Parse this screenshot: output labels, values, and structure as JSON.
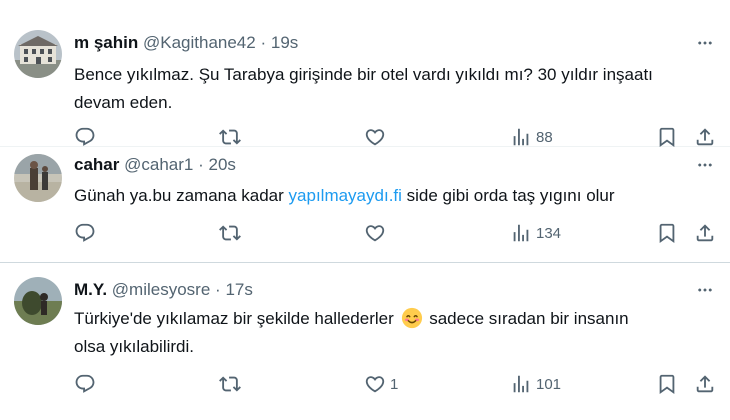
{
  "tweets": [
    {
      "name": "m şahin",
      "handle": "@Kagithane42",
      "separator": "·",
      "time": "19s",
      "text_lines": [
        "Bence yıkılmaz. Şu Tarabya girişinde bir otel vardı yıkıldı mı? 30 yıldır inşaatı",
        "devam eden."
      ],
      "likes": "",
      "views": "88"
    },
    {
      "name": "cahar",
      "handle": "@cahar1",
      "separator": "·",
      "time": "20s",
      "text_before_link": "Günah ya.bu zamana kadar ",
      "link_text": "yapılmayaydı.fi",
      "text_after_link": " side gibi orda taş yıgını olur",
      "likes": "",
      "views": "134"
    },
    {
      "name": "M.Y.",
      "handle": "@milesyosre",
      "separator": "·",
      "time": "17s",
      "text_line1_before_emoji": "Türkiye'de yıkılamaz bir şekilde hallederler ",
      "text_line1_after_emoji": " sadece sıradan bir insanın",
      "text_line2": "olsa yıkılabilirdi.",
      "likes": "1",
      "views": "101"
    }
  ],
  "colors": {
    "text": "#0f1419",
    "secondary": "#536471",
    "link": "#1d9bf0",
    "divider": "#eff3f4"
  },
  "icons": [
    "reply-icon",
    "retweet-icon",
    "like-icon",
    "views-icon",
    "bookmark-icon",
    "share-icon",
    "more-icon",
    "smiling-face-emoji"
  ]
}
